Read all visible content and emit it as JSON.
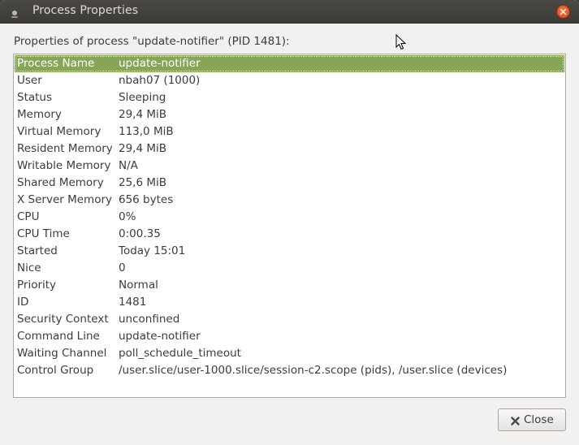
{
  "window": {
    "title": "Process Properties"
  },
  "heading": "Properties of process \"update-notifier\" (PID 1481):",
  "properties": [
    {
      "key": "Process Name",
      "value": "update-notifier"
    },
    {
      "key": "User",
      "value": "nbah07 (1000)"
    },
    {
      "key": "Status",
      "value": "Sleeping"
    },
    {
      "key": "Memory",
      "value": "29,4 MiB"
    },
    {
      "key": "Virtual Memory",
      "value": "113,0 MiB"
    },
    {
      "key": "Resident Memory",
      "value": "29,4 MiB"
    },
    {
      "key": "Writable Memory",
      "value": "N/A"
    },
    {
      "key": "Shared Memory",
      "value": "25,6 MiB"
    },
    {
      "key": "X Server Memory",
      "value": "656 bytes"
    },
    {
      "key": "CPU",
      "value": "0%"
    },
    {
      "key": "CPU Time",
      "value": "0:00.35"
    },
    {
      "key": "Started",
      "value": "Today 15:01"
    },
    {
      "key": "Nice",
      "value": "0"
    },
    {
      "key": "Priority",
      "value": "Normal"
    },
    {
      "key": "ID",
      "value": "1481"
    },
    {
      "key": "Security Context",
      "value": "unconfined"
    },
    {
      "key": "Command Line",
      "value": "update-notifier"
    },
    {
      "key": "Waiting Channel",
      "value": "poll_schedule_timeout"
    },
    {
      "key": "Control Group",
      "value": "/user.slice/user-1000.slice/session-c2.scope (pids), /user.slice (devices)"
    }
  ],
  "selected_index": 0,
  "buttons": {
    "close_label": "Close"
  },
  "colors": {
    "selection": "#87a556",
    "titlebar": "#3c3b37",
    "window_close": "#e9541f"
  },
  "icons": {
    "title": "app-icon",
    "window_close": "close-icon",
    "close_button": "x-icon",
    "pointer": "mouse-pointer-icon"
  }
}
